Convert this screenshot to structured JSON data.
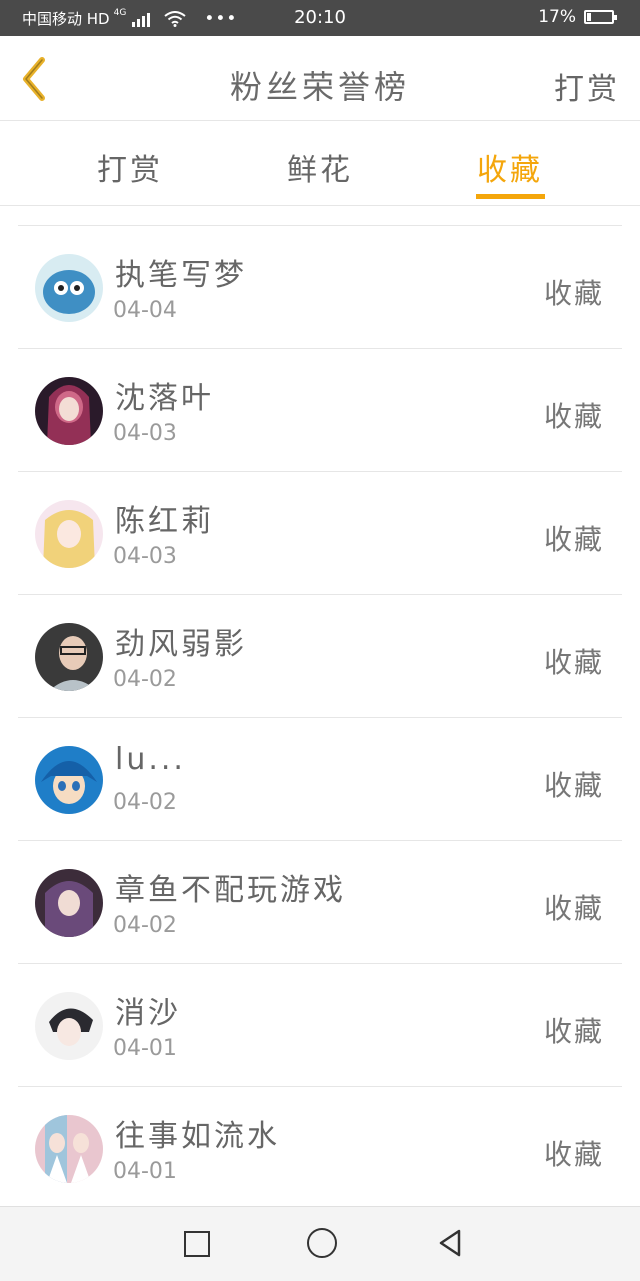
{
  "status_bar": {
    "carrier": "中国移动 HD",
    "network": "4G",
    "time": "20:10",
    "battery": "17%",
    "battery_level": 0.17
  },
  "header": {
    "title": "粉丝荣誉榜",
    "right_action": "打赏",
    "accent_color": "#e8b12a"
  },
  "tabs": [
    {
      "label": "打赏"
    },
    {
      "label": "鲜花"
    },
    {
      "label": "收藏",
      "active": true
    }
  ],
  "colors": {
    "active_tab": "#f4a60b",
    "text": "#666666",
    "muted": "#9a9a9a",
    "divider": "#e6e6e6"
  },
  "items": [
    {
      "name": "执笔写梦",
      "date": "04-04",
      "action": "收藏"
    },
    {
      "name": "沈落叶",
      "date": "04-03",
      "action": "收藏"
    },
    {
      "name": "陈红莉",
      "date": "04-03",
      "action": "收藏"
    },
    {
      "name": "劲风弱影",
      "date": "04-02",
      "action": "收藏"
    },
    {
      "name": "lu...",
      "date": "04-02",
      "action": "收藏"
    },
    {
      "name": "章鱼不配玩游戏",
      "date": "04-02",
      "action": "收藏"
    },
    {
      "name": "消沙",
      "date": "04-01",
      "action": "收藏"
    },
    {
      "name": "往事如流水",
      "date": "04-01",
      "action": "收藏"
    }
  ]
}
